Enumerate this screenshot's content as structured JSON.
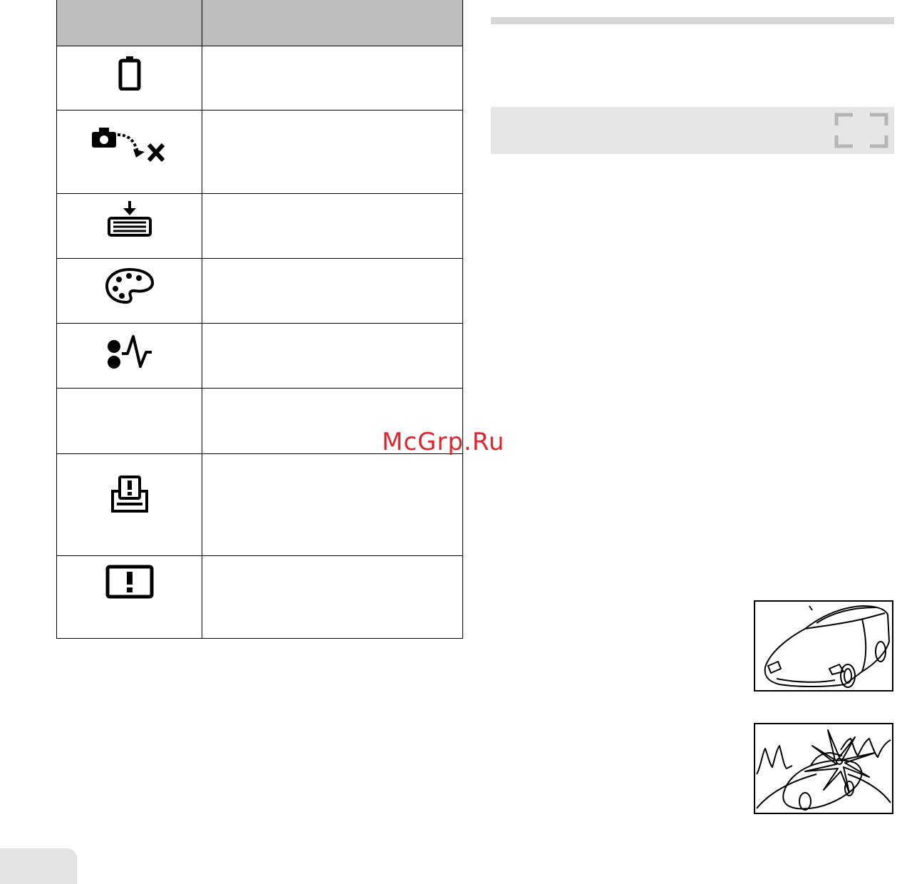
{
  "table": {
    "header": {
      "col1": "",
      "col2": ""
    },
    "rows": [
      {
        "icon": "battery-icon",
        "text": ""
      },
      {
        "icon": "camera-no-connection-icon",
        "text": ""
      },
      {
        "icon": "no-paper-icon",
        "text": ""
      },
      {
        "icon": "no-ink-icon",
        "text": ""
      },
      {
        "icon": "jammed-icon",
        "text": ""
      },
      {
        "icon": "",
        "text": ""
      },
      {
        "icon": "printer-error-icon",
        "text": ""
      },
      {
        "icon": "cannot-print-icon",
        "text": ""
      }
    ]
  },
  "right_panel": {
    "section_icon": "frame-corners-icon"
  },
  "watermark": {
    "text": "McGrp.Ru"
  },
  "illustrations": [
    {
      "icon": "car-illustration"
    },
    {
      "icon": "car-backlit-illustration"
    }
  ],
  "colors": {
    "header_gray": "#bdbdbd",
    "bar_gray": "#e6e6e6",
    "rule_gray": "#d6d6d6",
    "watermark_red": "#e0262c"
  }
}
